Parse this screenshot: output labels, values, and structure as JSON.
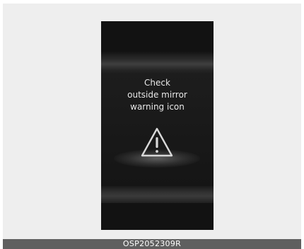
{
  "display": {
    "message_lines": [
      "Check",
      "outside mirror",
      "warning icon"
    ],
    "icon": "warning-triangle-icon"
  },
  "caption": {
    "code": "OSP2052309R"
  },
  "colors": {
    "screen_background": "#121212",
    "text": "#e8e8e8",
    "caption_bar": "#5f5f5f"
  }
}
